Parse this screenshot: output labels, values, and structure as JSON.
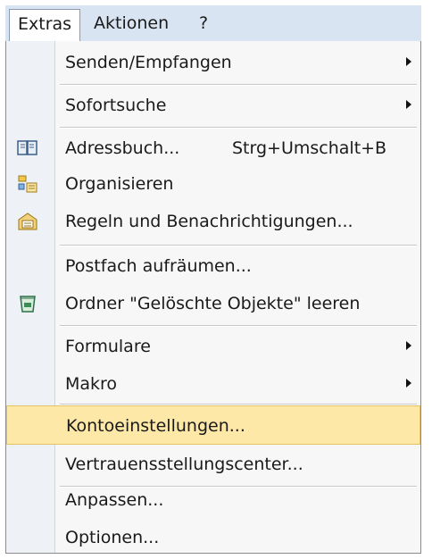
{
  "menubar": {
    "items": [
      {
        "label": "Extras",
        "active": true
      },
      {
        "label": "Aktionen",
        "active": false
      },
      {
        "label": "?",
        "active": false
      }
    ]
  },
  "menu": {
    "items": [
      {
        "label": "Senden/Empfangen",
        "submenu": true
      },
      {
        "label": "Sofortsuche",
        "submenu": true
      },
      {
        "label": "Adressbuch...",
        "shortcut": "Strg+Umschalt+B",
        "icon": "address-book-icon"
      },
      {
        "label": "Organisieren",
        "icon": "organize-icon"
      },
      {
        "label": "Regeln und Benachrichtigungen...",
        "icon": "rules-icon"
      },
      {
        "label": "Postfach aufräumen..."
      },
      {
        "label": "Ordner \"Gelöschte Objekte\" leeren",
        "icon": "empty-trash-icon"
      },
      {
        "label": "Formulare",
        "submenu": true
      },
      {
        "label": "Makro",
        "submenu": true
      },
      {
        "label": "Kontoeinstellungen...",
        "highlighted": true
      },
      {
        "label": "Vertrauensstellungscenter..."
      },
      {
        "label": "Anpassen..."
      },
      {
        "label": "Optionen..."
      }
    ]
  },
  "colors": {
    "highlight": "#fde8a8",
    "menubar": "#d9e4f2",
    "gutter": "#eef1f5"
  }
}
